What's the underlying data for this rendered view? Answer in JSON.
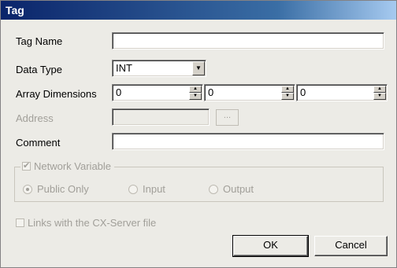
{
  "title": "Tag",
  "fields": {
    "tag_name_label": "Tag Name",
    "tag_name_value": "",
    "data_type_label": "Data Type",
    "data_type_value": "INT",
    "array_dims_label": "Array Dimensions",
    "array_dims_values": [
      "0",
      "0",
      "0"
    ],
    "address_label": "Address",
    "address_button": "...",
    "comment_label": "Comment",
    "comment_value": ""
  },
  "network": {
    "label": "Network Variable",
    "options": [
      "Public Only",
      "Input",
      "Output"
    ],
    "selected": "Public Only"
  },
  "links_label": "Links with the CX-Server file",
  "buttons": {
    "ok": "OK",
    "cancel": "Cancel"
  }
}
